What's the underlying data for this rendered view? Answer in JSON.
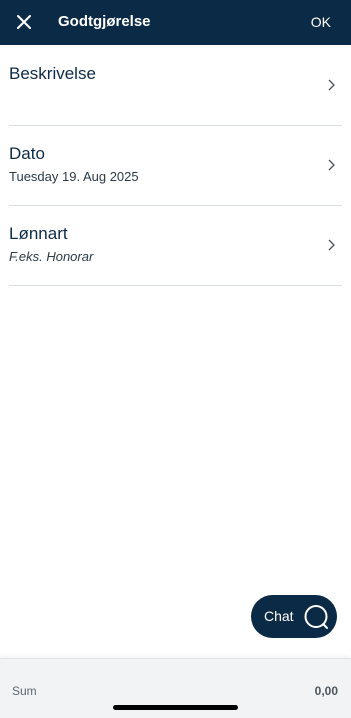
{
  "header": {
    "title": "Godtgjørelse",
    "ok_label": "OK",
    "close_icon": "close-icon"
  },
  "rows": [
    {
      "label": "Beskrivelse",
      "sub": ""
    },
    {
      "label": "Dato",
      "sub": "Tuesday 19. Aug 2025"
    },
    {
      "label": "Lønnart",
      "sub": "F.eks. Honorar"
    }
  ],
  "chat": {
    "label": "Chat",
    "icon": "chat-bubble-icon"
  },
  "footer": {
    "sum_label": "Sum",
    "sum_value": "0,00"
  },
  "colors": {
    "header_bg": "#0b2a45",
    "text_primary": "#0d2b45",
    "divider": "#d8dde2",
    "footer_bg": "#f2f3f4"
  }
}
